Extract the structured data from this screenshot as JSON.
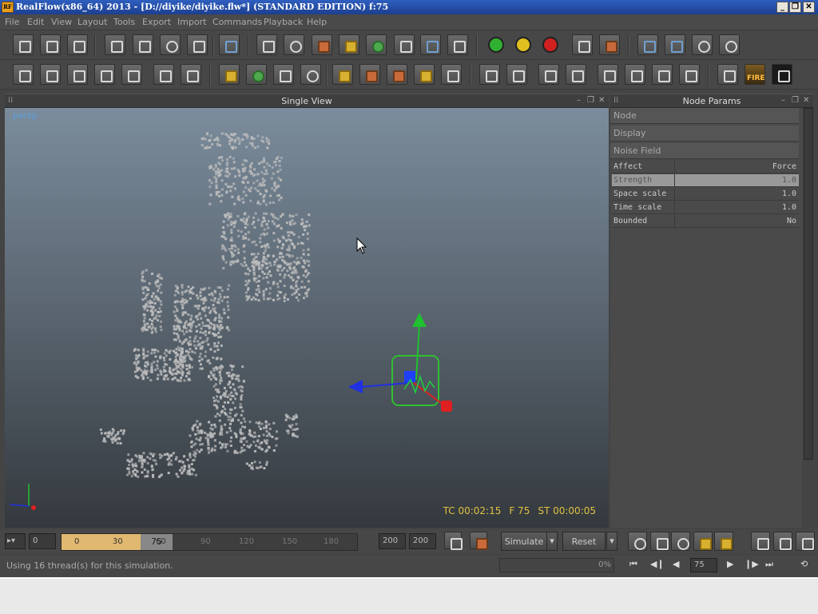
{
  "window": {
    "title": "RealFlow(x86_64) 2013 - [D://diyike/diyike.flw*] (STANDARD EDITION) f:75",
    "logo_text": "RF",
    "minimize": "_",
    "maximize": "❐",
    "close": "✕"
  },
  "menu": [
    "File",
    "Edit",
    "View",
    "Layout",
    "Tools",
    "Export",
    "Import",
    "Commands",
    "Playback",
    "Help"
  ],
  "panes": {
    "viewport_title": "Single View",
    "params_title": "Node Params",
    "ctl_min": "–",
    "ctl_restore": "❐",
    "ctl_close": "✕",
    "grip": "⁞⁞"
  },
  "viewport": {
    "camera": "persp",
    "hud": {
      "tc": "TC 00:02:15",
      "frame": "F 75",
      "st": "ST 00:00:05"
    }
  },
  "node_params": {
    "sections": [
      "Node",
      "Display",
      "Noise Field"
    ],
    "rows": [
      {
        "key": "Affect",
        "value": "Force"
      },
      {
        "key": "Strength",
        "value": "1.0"
      },
      {
        "key": "Space scale",
        "value": "1.0"
      },
      {
        "key": "Time scale",
        "value": "1.0"
      },
      {
        "key": "Bounded",
        "value": "No"
      }
    ]
  },
  "timeline": {
    "start_field": "0",
    "current_frame": "75",
    "ticks": [
      "0",
      "30",
      "60",
      "90",
      "120",
      "150",
      "180"
    ],
    "end_field_1": "200",
    "end_field_2": "200",
    "current_fraction": 0.375,
    "simulate_label": "Simulate",
    "reset_label": "Reset"
  },
  "status": {
    "message": "Using 16 thread(s) for this simulation.",
    "progress": "0%",
    "frame_field": "75"
  },
  "playback": {
    "first": "⏮",
    "prev_key": "◀❙",
    "prev": "◀",
    "play": "▶",
    "next_key": "❙▶",
    "last": "⏭",
    "loop": "⟲"
  },
  "toolbar": {
    "fire_label": "FIRE"
  },
  "colors": {
    "hud": "#e0c040",
    "axis_x": "#2030e0",
    "axis_y": "#20c030",
    "axis_z": "#e02020",
    "selection": "#30c030",
    "particles": "#bcbcbc"
  }
}
